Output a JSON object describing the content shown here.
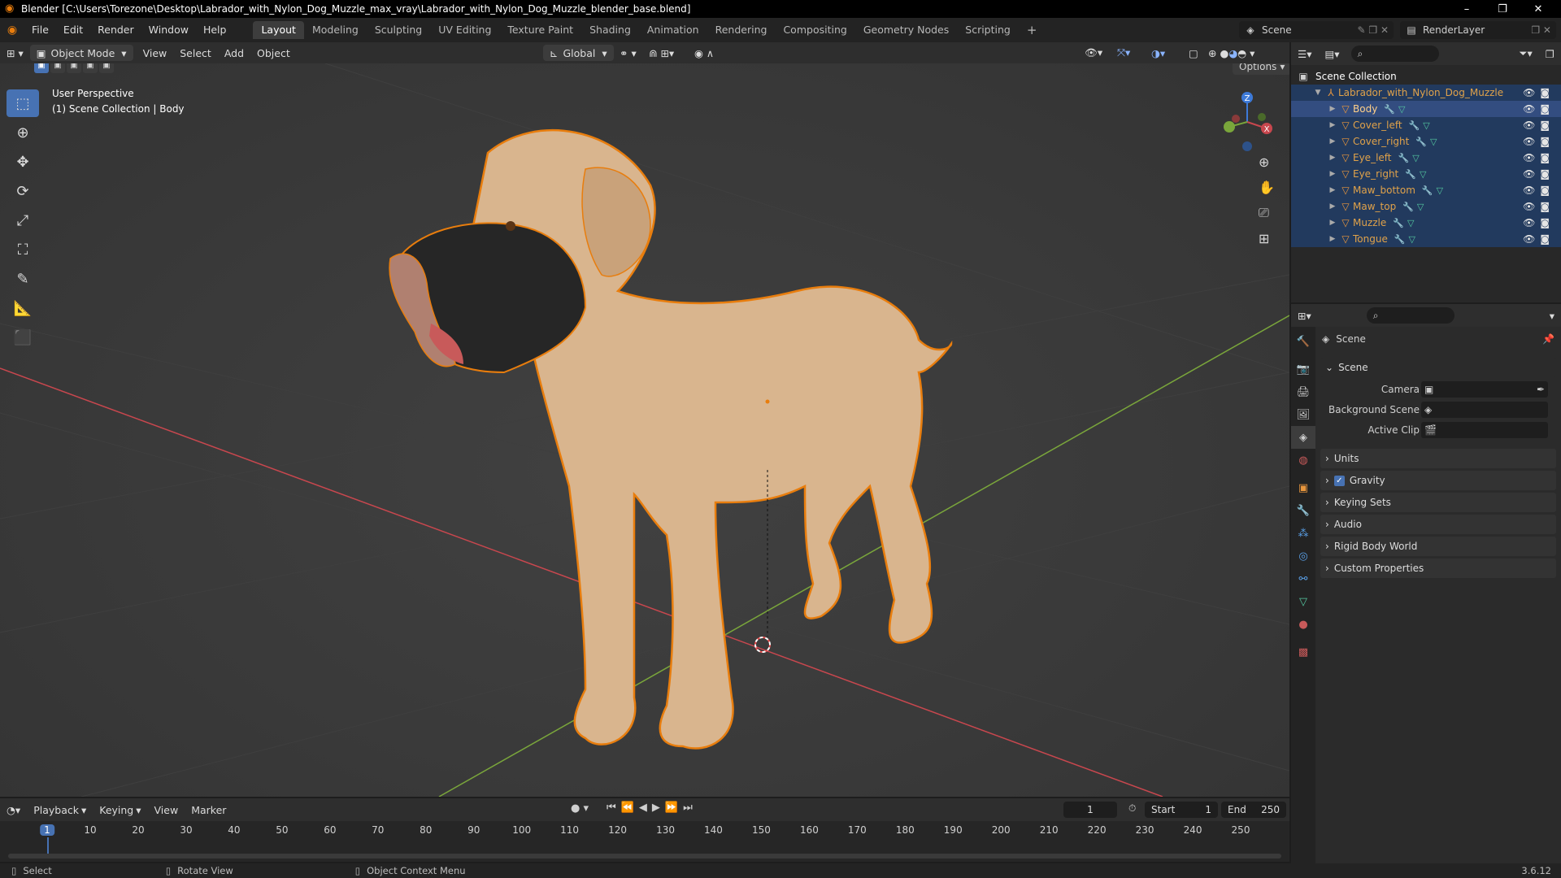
{
  "window": {
    "title": "Blender [C:\\Users\\Torezone\\Desktop\\Labrador_with_Nylon_Dog_Muzzle_max_vray\\Labrador_with_Nylon_Dog_Muzzle_blender_base.blend]",
    "minimize": "–",
    "maximize": "❐",
    "close": "✕"
  },
  "menu": [
    "File",
    "Edit",
    "Render",
    "Window",
    "Help"
  ],
  "workspaces": [
    {
      "label": "Layout",
      "active": true
    },
    {
      "label": "Modeling"
    },
    {
      "label": "Sculpting"
    },
    {
      "label": "UV Editing"
    },
    {
      "label": "Texture Paint"
    },
    {
      "label": "Shading"
    },
    {
      "label": "Animation"
    },
    {
      "label": "Rendering"
    },
    {
      "label": "Compositing"
    },
    {
      "label": "Geometry Nodes"
    },
    {
      "label": "Scripting"
    }
  ],
  "add_workspace": "+",
  "scene_selector": "Scene",
  "render_layer": "RenderLayer",
  "viewport": {
    "mode": "Object Mode",
    "menus": [
      "View",
      "Select",
      "Add",
      "Object"
    ],
    "transform_orientation": "Global",
    "options_label": "Options",
    "info_line1": "User Perspective",
    "info_line2": "(1) Scene Collection | Body",
    "gizmo_axes": {
      "x": "X",
      "y": "Y",
      "z": "Z"
    }
  },
  "outliner": {
    "root": "Scene Collection",
    "collection": "Labrador_with_Nylon_Dog_Muzzle",
    "objects": [
      "Body",
      "Cover_left",
      "Cover_right",
      "Eye_left",
      "Eye_right",
      "Maw_bottom",
      "Maw_top",
      "Muzzle",
      "Tongue"
    ]
  },
  "properties": {
    "header_title": "Scene",
    "section": "Scene",
    "fields": [
      {
        "label": "Camera"
      },
      {
        "label": "Background Scene"
      },
      {
        "label": "Active Clip"
      }
    ],
    "panels": [
      "Units",
      "Gravity",
      "Keying Sets",
      "Audio",
      "Rigid Body World",
      "Custom Properties"
    ],
    "gravity_checked": true
  },
  "timeline": {
    "menus": [
      "Playback",
      "Keying",
      "View",
      "Marker"
    ],
    "current_frame": "1",
    "start_label": "Start",
    "start_value": "1",
    "end_label": "End",
    "end_value": "250",
    "ticks": [
      "1",
      "10",
      "20",
      "30",
      "40",
      "50",
      "60",
      "70",
      "80",
      "90",
      "100",
      "110",
      "120",
      "130",
      "140",
      "150",
      "160",
      "170",
      "180",
      "190",
      "200",
      "210",
      "220",
      "230",
      "240",
      "250"
    ]
  },
  "statusbar": {
    "select": "Select",
    "rotate": "Rotate View",
    "context": "Object Context Menu",
    "version": "3.6.12"
  },
  "colors": {
    "accent": "#4772b3",
    "selection_outline": "#e87d0d",
    "x_axis": "#c8474e",
    "y_axis": "#7aa63b",
    "z_axis": "#3d7ad8"
  }
}
